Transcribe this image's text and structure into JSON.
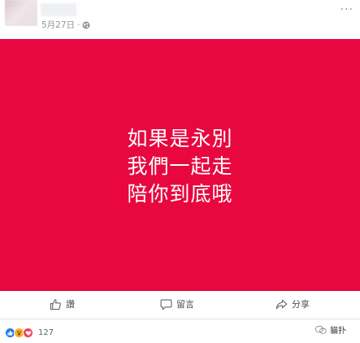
{
  "post": {
    "date": "5月27日",
    "separator": "·",
    "more_glyph": "···"
  },
  "image": {
    "background_color": "#e8073f",
    "text_color": "#ffffff",
    "lines": [
      "如果是永別",
      "我們一起走",
      "陪你到底哦"
    ]
  },
  "actions": {
    "like_label": "讚",
    "comment_label": "留言",
    "share_label": "分享"
  },
  "reactions": {
    "types": [
      "like",
      "wow",
      "love"
    ],
    "count": "127"
  },
  "watermark": {
    "label": "貓扑"
  }
}
